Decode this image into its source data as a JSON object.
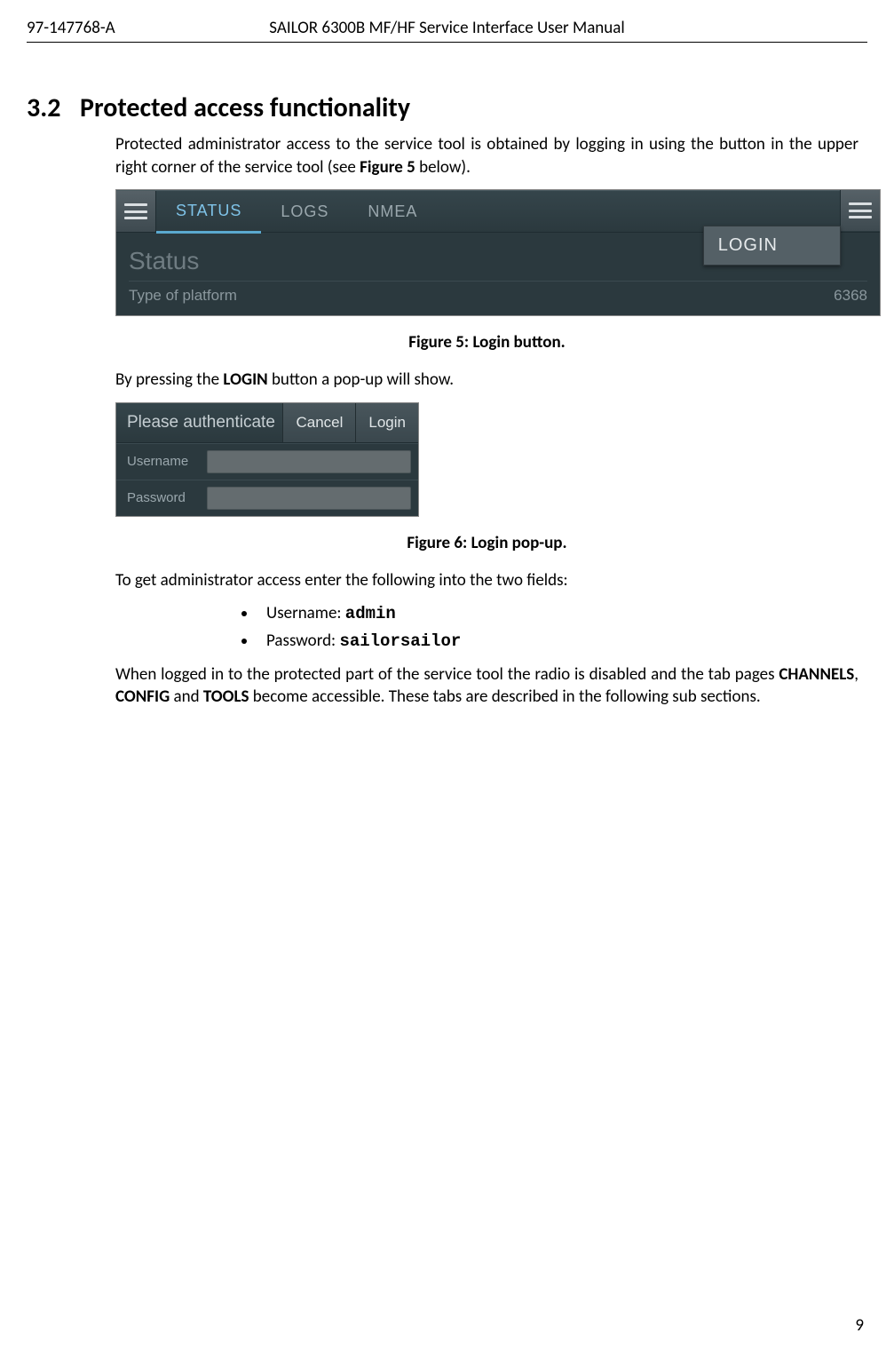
{
  "header": {
    "doc_number": "97-147768-A",
    "title": "SAILOR 6300B MF/HF Service Interface User Manual"
  },
  "section": {
    "number": "3.2",
    "title": "Protected access functionality",
    "intro_pre": "Protected administrator access to the service tool is obtained by logging in using the button in the upper right corner of the service tool (see ",
    "intro_ref": "Figure 5",
    "intro_post": " below)."
  },
  "figure5": {
    "caption": "Figure 5: Login button.",
    "tabs": {
      "status": "STATUS",
      "logs": "LOGS",
      "nmea": "NMEA"
    },
    "login_label": "LOGIN",
    "status_title": "Status",
    "row_label": "Type of platform",
    "row_value": "6368"
  },
  "after_fig5_pre": "By pressing the ",
  "after_fig5_bold": "LOGIN",
  "after_fig5_post": " button a pop-up will show.",
  "figure6": {
    "caption": "Figure 6: Login pop-up.",
    "title": "Please authenticate",
    "cancel": "Cancel",
    "login": "Login",
    "username_label": "Username",
    "password_label": "Password"
  },
  "after_fig6": {
    "intro": "To get administrator access enter the following into the two fields:",
    "bullets": {
      "user_label": "Username: ",
      "user_value": "admin",
      "pass_label": "Password: ",
      "pass_value": "sailorsailor"
    },
    "tail_1": "When logged in to the protected part of the service tool the radio is disabled and the tab pages ",
    "tab1": "CHANNELS",
    "sep1": ", ",
    "tab2": "CONFIG",
    "sep2": " and ",
    "tab3": "TOOLS",
    "tail_2": " become accessible. These tabs are described in the following sub sections."
  },
  "page_number": "9"
}
